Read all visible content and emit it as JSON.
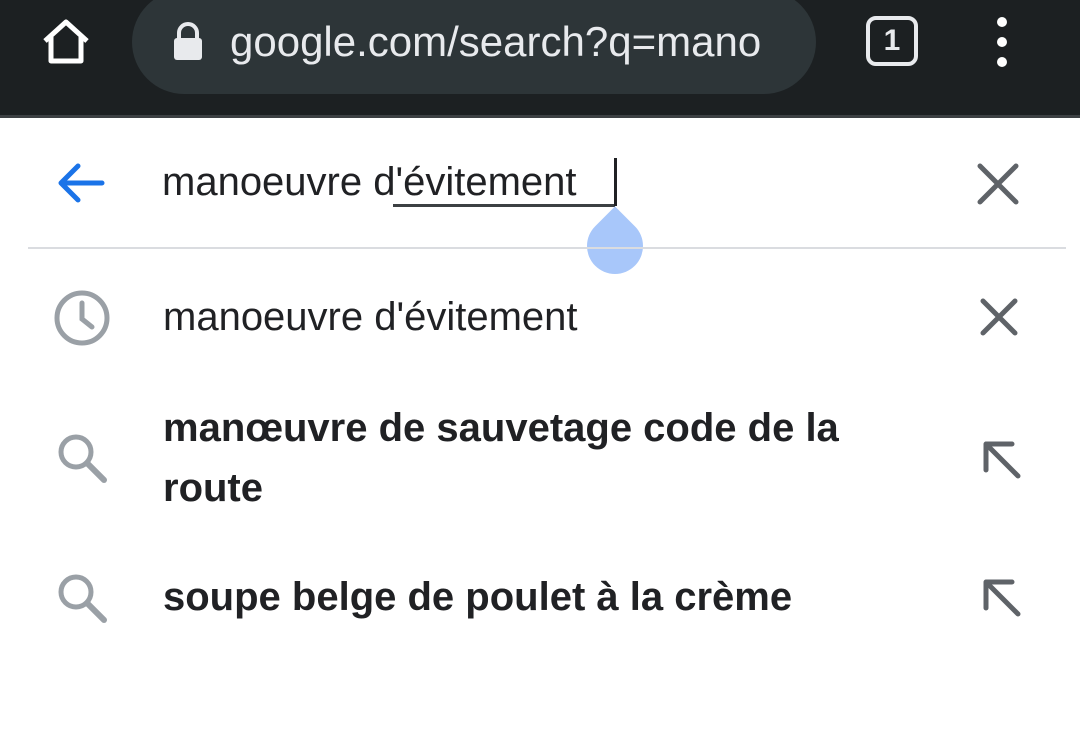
{
  "toolbar": {
    "url": "google.com/search?q=mano",
    "tab_count": "1",
    "icons": {
      "home": "home-icon",
      "lock": "lock-icon",
      "menu": "more-vert-icon"
    }
  },
  "search": {
    "query": "manoeuvre d'évitement",
    "icons": {
      "back": "arrow-back-icon",
      "clear": "close-icon"
    },
    "accent": "#1a73e8"
  },
  "suggestions": [
    {
      "text": "manoeuvre d'évitement",
      "type": "history",
      "icon": "history-icon",
      "action_icon": "close-icon"
    },
    {
      "text": "manœuvre de sauvetage code de la route",
      "type": "search",
      "icon": "search-icon",
      "action_icon": "arrow-up-left-icon"
    },
    {
      "text": "soupe belge de poulet à la crème",
      "type": "search",
      "icon": "search-icon",
      "action_icon": "arrow-up-left-icon"
    }
  ]
}
